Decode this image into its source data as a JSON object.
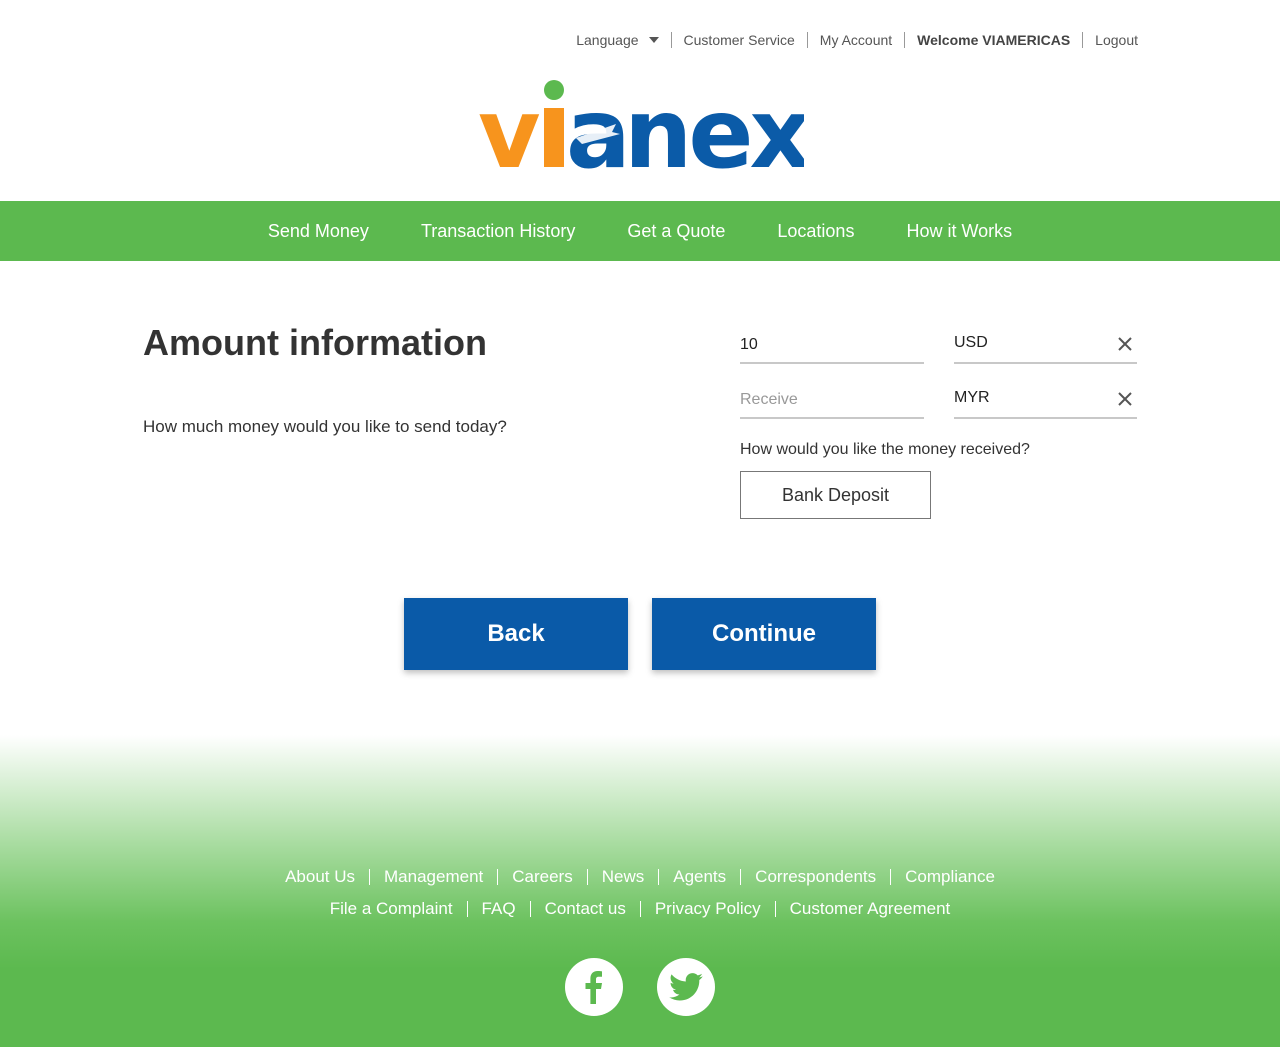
{
  "topbar": {
    "language": "Language",
    "customer_service": "Customer Service",
    "my_account": "My Account",
    "welcome": "Welcome VIAMERICAS",
    "logout": "Logout"
  },
  "logo": {
    "text": "vianex"
  },
  "nav": {
    "items": [
      "Send Money",
      "Transaction History",
      "Get a Quote",
      "Locations",
      "How it Works"
    ]
  },
  "main": {
    "title": "Amount information",
    "question": "How much money would you like to send today?",
    "send_amount": "10",
    "send_currency": "USD",
    "receive_placeholder": "Receive",
    "receive_currency": "MYR",
    "receive_question": "How would you like the money received?",
    "delivery_option": "Bank Deposit",
    "back_label": "Back",
    "continue_label": "Continue"
  },
  "footer": {
    "row1": [
      "About Us",
      "Management",
      "Careers",
      "News",
      "Agents",
      "Correspondents",
      "Compliance"
    ],
    "row2": [
      "File a Complaint",
      "FAQ",
      "Contact us",
      "Privacy Policy",
      "Customer Agreement"
    ],
    "social": [
      "facebook-icon",
      "twitter-icon"
    ]
  },
  "colors": {
    "brand_green": "#5cb94f",
    "brand_blue": "#0a5aa8",
    "logo_orange": "#f7941d",
    "logo_blue": "#0b5ba8"
  }
}
